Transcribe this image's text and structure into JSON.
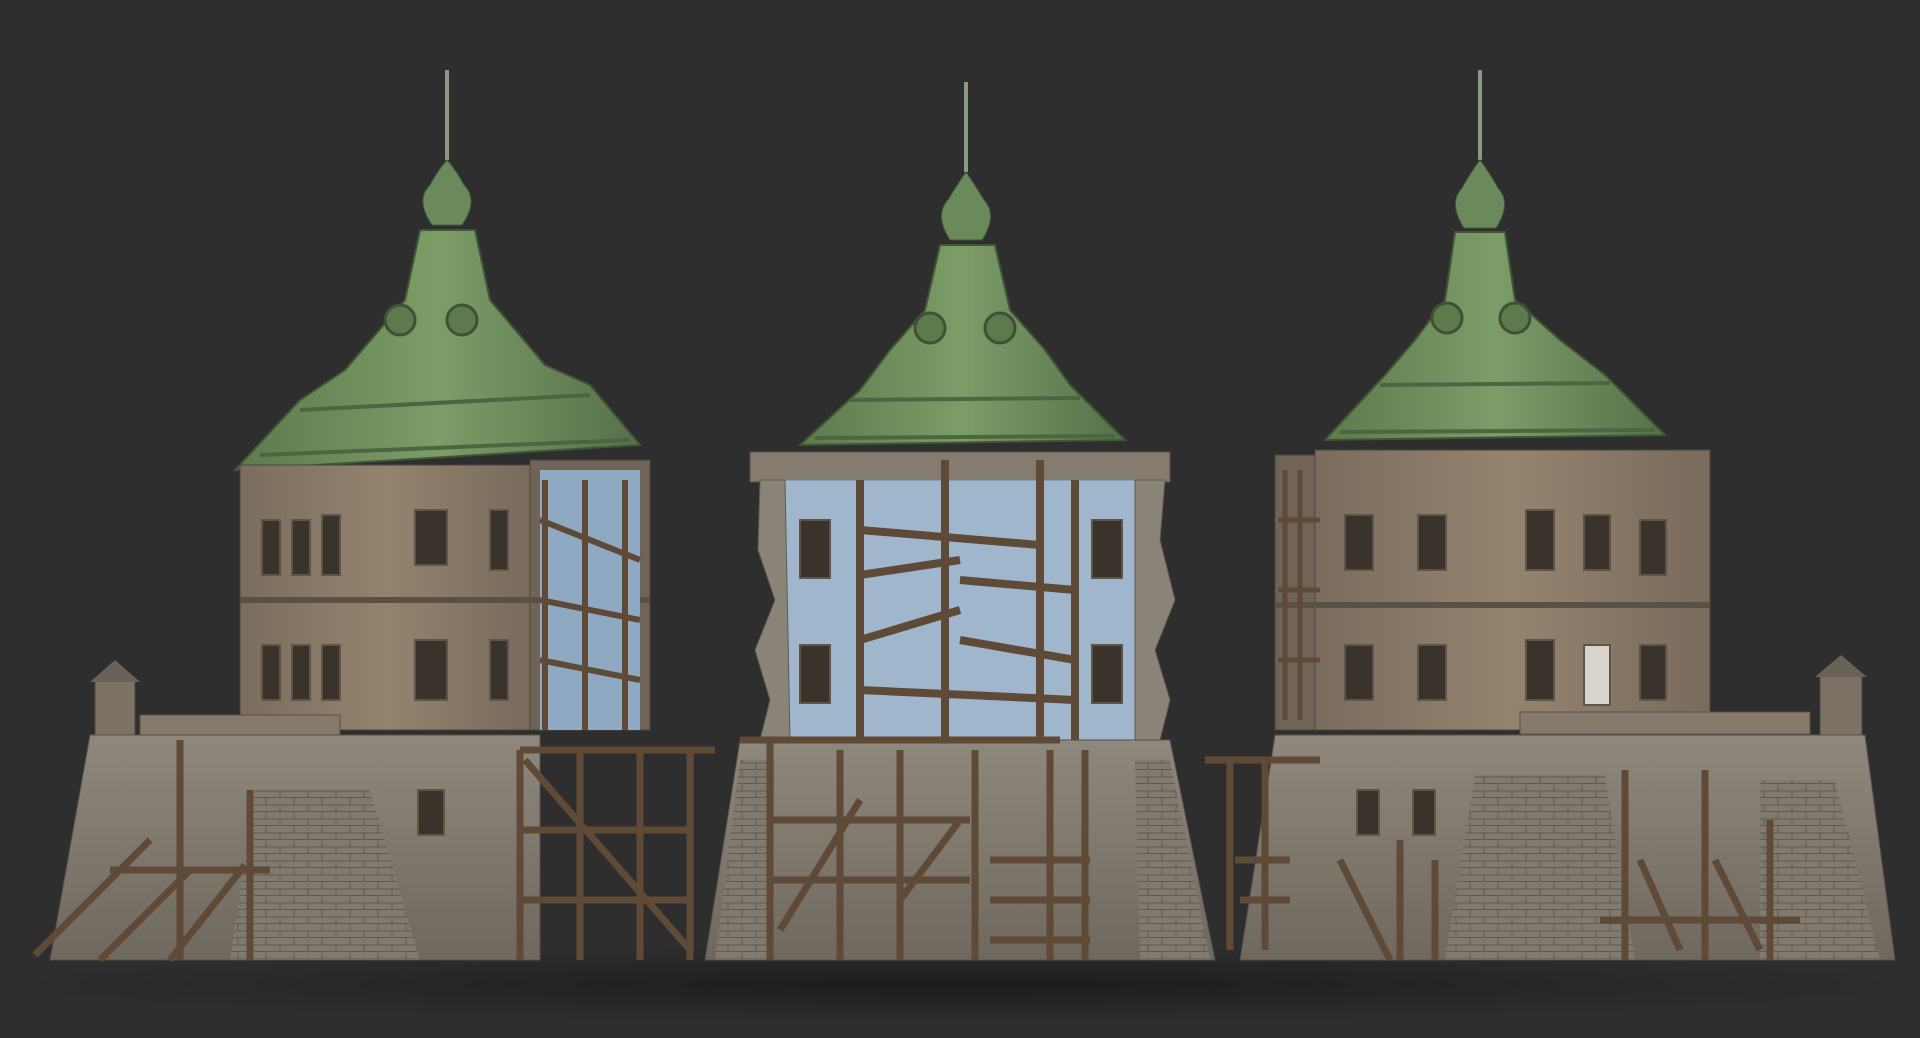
{
  "scene": {
    "background_color": "#2e2e2e",
    "ground_shadow_color": "#1f1f1f",
    "roof_color": "#6e8f5c",
    "roof_shadow_color": "#4f6d43",
    "wall_color": "#8c7d6c",
    "stone_color": "#8a8378",
    "plaster_blue_color": "#9fb6cc",
    "timber_color": "#5e4a36",
    "window_color": "#3a332c"
  },
  "buildings": [
    {
      "view": "front-left",
      "damage_side": "right"
    },
    {
      "view": "cutaway",
      "damage_side": "center"
    },
    {
      "view": "front-right",
      "damage_side": "left"
    }
  ]
}
